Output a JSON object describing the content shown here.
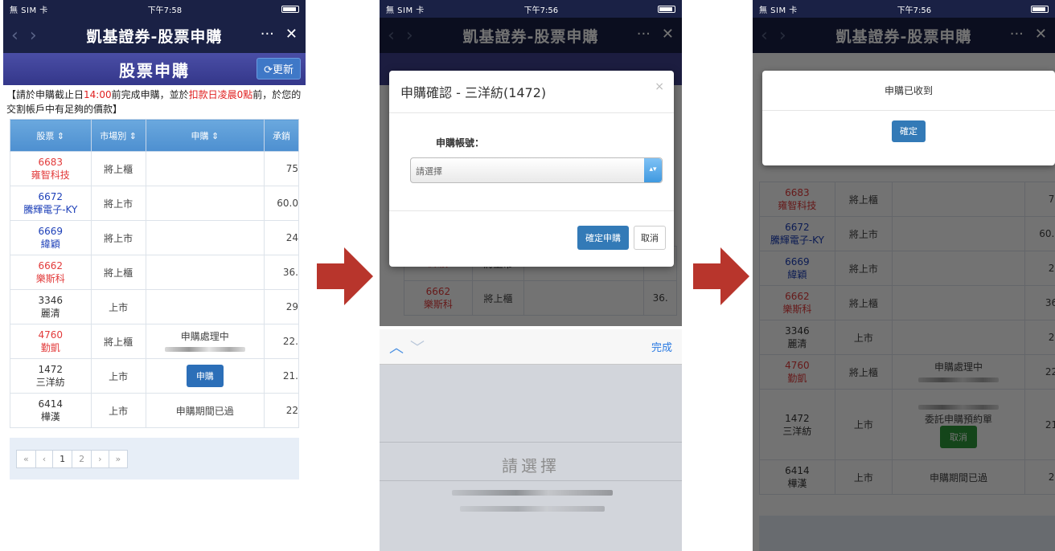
{
  "status": {
    "carrier": "無 SIM 卡",
    "time1": "下午7:58",
    "time2": "下午7:56",
    "time3": "下午7:56"
  },
  "nav": {
    "title": "凱基證券-股票申購",
    "more": "···",
    "close": "✕",
    "back": "‹",
    "forward": "›"
  },
  "page": {
    "title": "股票申購",
    "refresh": "更新",
    "refresh_icon": "⟳"
  },
  "notice": {
    "part1": "【請於申購截止日",
    "time": "14:00",
    "part2": "前完成申購，並於",
    "deduct": "扣款日凌晨0點",
    "part3": "前，於您的交割帳戶中有足夠的價款】"
  },
  "table": {
    "headers": [
      "股票 ⇕",
      "市場別 ⇕",
      "申購 ⇕",
      "承銷"
    ],
    "rows": [
      {
        "code": "6683",
        "name": "雍智科技",
        "color": "red",
        "market": "將上櫃",
        "action": "",
        "price": "75"
      },
      {
        "code": "6672",
        "name": "騰輝電子-KY",
        "color": "blue",
        "market": "將上市",
        "action": "",
        "price": "60.0"
      },
      {
        "code": "6669",
        "name": "緯穎",
        "color": "blue",
        "market": "將上市",
        "action": "",
        "price": "24"
      },
      {
        "code": "6662",
        "name": "樂斯科",
        "color": "red",
        "market": "將上櫃",
        "action": "",
        "price": "36."
      },
      {
        "code": "3346",
        "name": "麗清",
        "color": "black",
        "market": "上市",
        "action": "",
        "price": "29"
      },
      {
        "code": "4760",
        "name": "勤凱",
        "color": "red",
        "market": "將上櫃",
        "action": "申購處理中",
        "price": "22."
      },
      {
        "code": "1472",
        "name": "三洋紡",
        "color": "black",
        "market": "上市",
        "action": "申購",
        "price": "21."
      },
      {
        "code": "6414",
        "name": "樺漢",
        "color": "black",
        "market": "上市",
        "action": "申購期間已過",
        "price": "22"
      }
    ]
  },
  "pager": [
    "«",
    "‹",
    "1",
    "2",
    "›",
    "»"
  ],
  "modal": {
    "title": "申購確認 - 三洋紡(1472)",
    "close": "×",
    "label": "申購帳號：",
    "placeholder": "請選擇",
    "confirm": "確定申購",
    "cancel": "取消"
  },
  "picker": {
    "done": "完成",
    "value": "請選擇",
    "up": "︿",
    "down": "﹀"
  },
  "result": {
    "message": "申購已收到",
    "ok": "確定",
    "pending": "委託申購預約單",
    "cancel": "取消"
  },
  "colors": {
    "navy": "#1a2145",
    "header": "#3e418f",
    "accent": "#337ab7",
    "arrow": "#b8352c"
  }
}
